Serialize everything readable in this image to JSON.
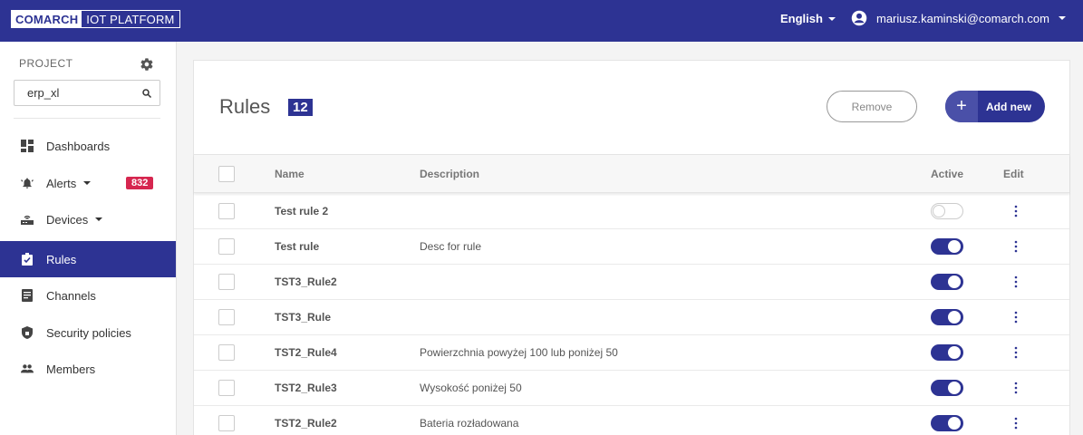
{
  "brand": {
    "logo_part1": "COMARCH",
    "logo_part2": "IOT PLATFORM"
  },
  "header": {
    "language": "English",
    "user_email": "mariusz.kaminski@comarch.com"
  },
  "sidebar": {
    "project_label": "PROJECT",
    "project_search_value": "erp_xl",
    "items": [
      {
        "label": "Dashboards",
        "icon": "dashboard-icon"
      },
      {
        "label": "Alerts",
        "icon": "bell-icon",
        "badge": "832"
      },
      {
        "label": "Devices",
        "icon": "router-icon"
      },
      {
        "label": "Rules",
        "icon": "clipboard-check-icon",
        "active": true
      },
      {
        "label": "Channels",
        "icon": "document-icon"
      },
      {
        "label": "Security policies",
        "icon": "shield-icon"
      },
      {
        "label": "Members",
        "icon": "people-icon"
      }
    ]
  },
  "main": {
    "title": "Rules",
    "count": "12",
    "remove_label": "Remove",
    "add_label": "Add new",
    "columns": {
      "name": "Name",
      "description": "Description",
      "active": "Active",
      "edit": "Edit"
    },
    "rows": [
      {
        "name": "Test rule 2",
        "description": "",
        "active": false
      },
      {
        "name": "Test rule",
        "description": "Desc for rule",
        "active": true
      },
      {
        "name": "TST3_Rule2",
        "description": "",
        "active": true
      },
      {
        "name": "TST3_Rule",
        "description": "",
        "active": true
      },
      {
        "name": "TST2_Rule4",
        "description": "Powierzchnia powyżej 100 lub poniżej 50",
        "active": true
      },
      {
        "name": "TST2_Rule3",
        "description": "Wysokość poniżej 50",
        "active": true
      },
      {
        "name": "TST2_Rule2",
        "description": "Bateria rozładowana",
        "active": true
      }
    ]
  },
  "colors": {
    "primary": "#2d3393",
    "badge": "#d6264f"
  }
}
